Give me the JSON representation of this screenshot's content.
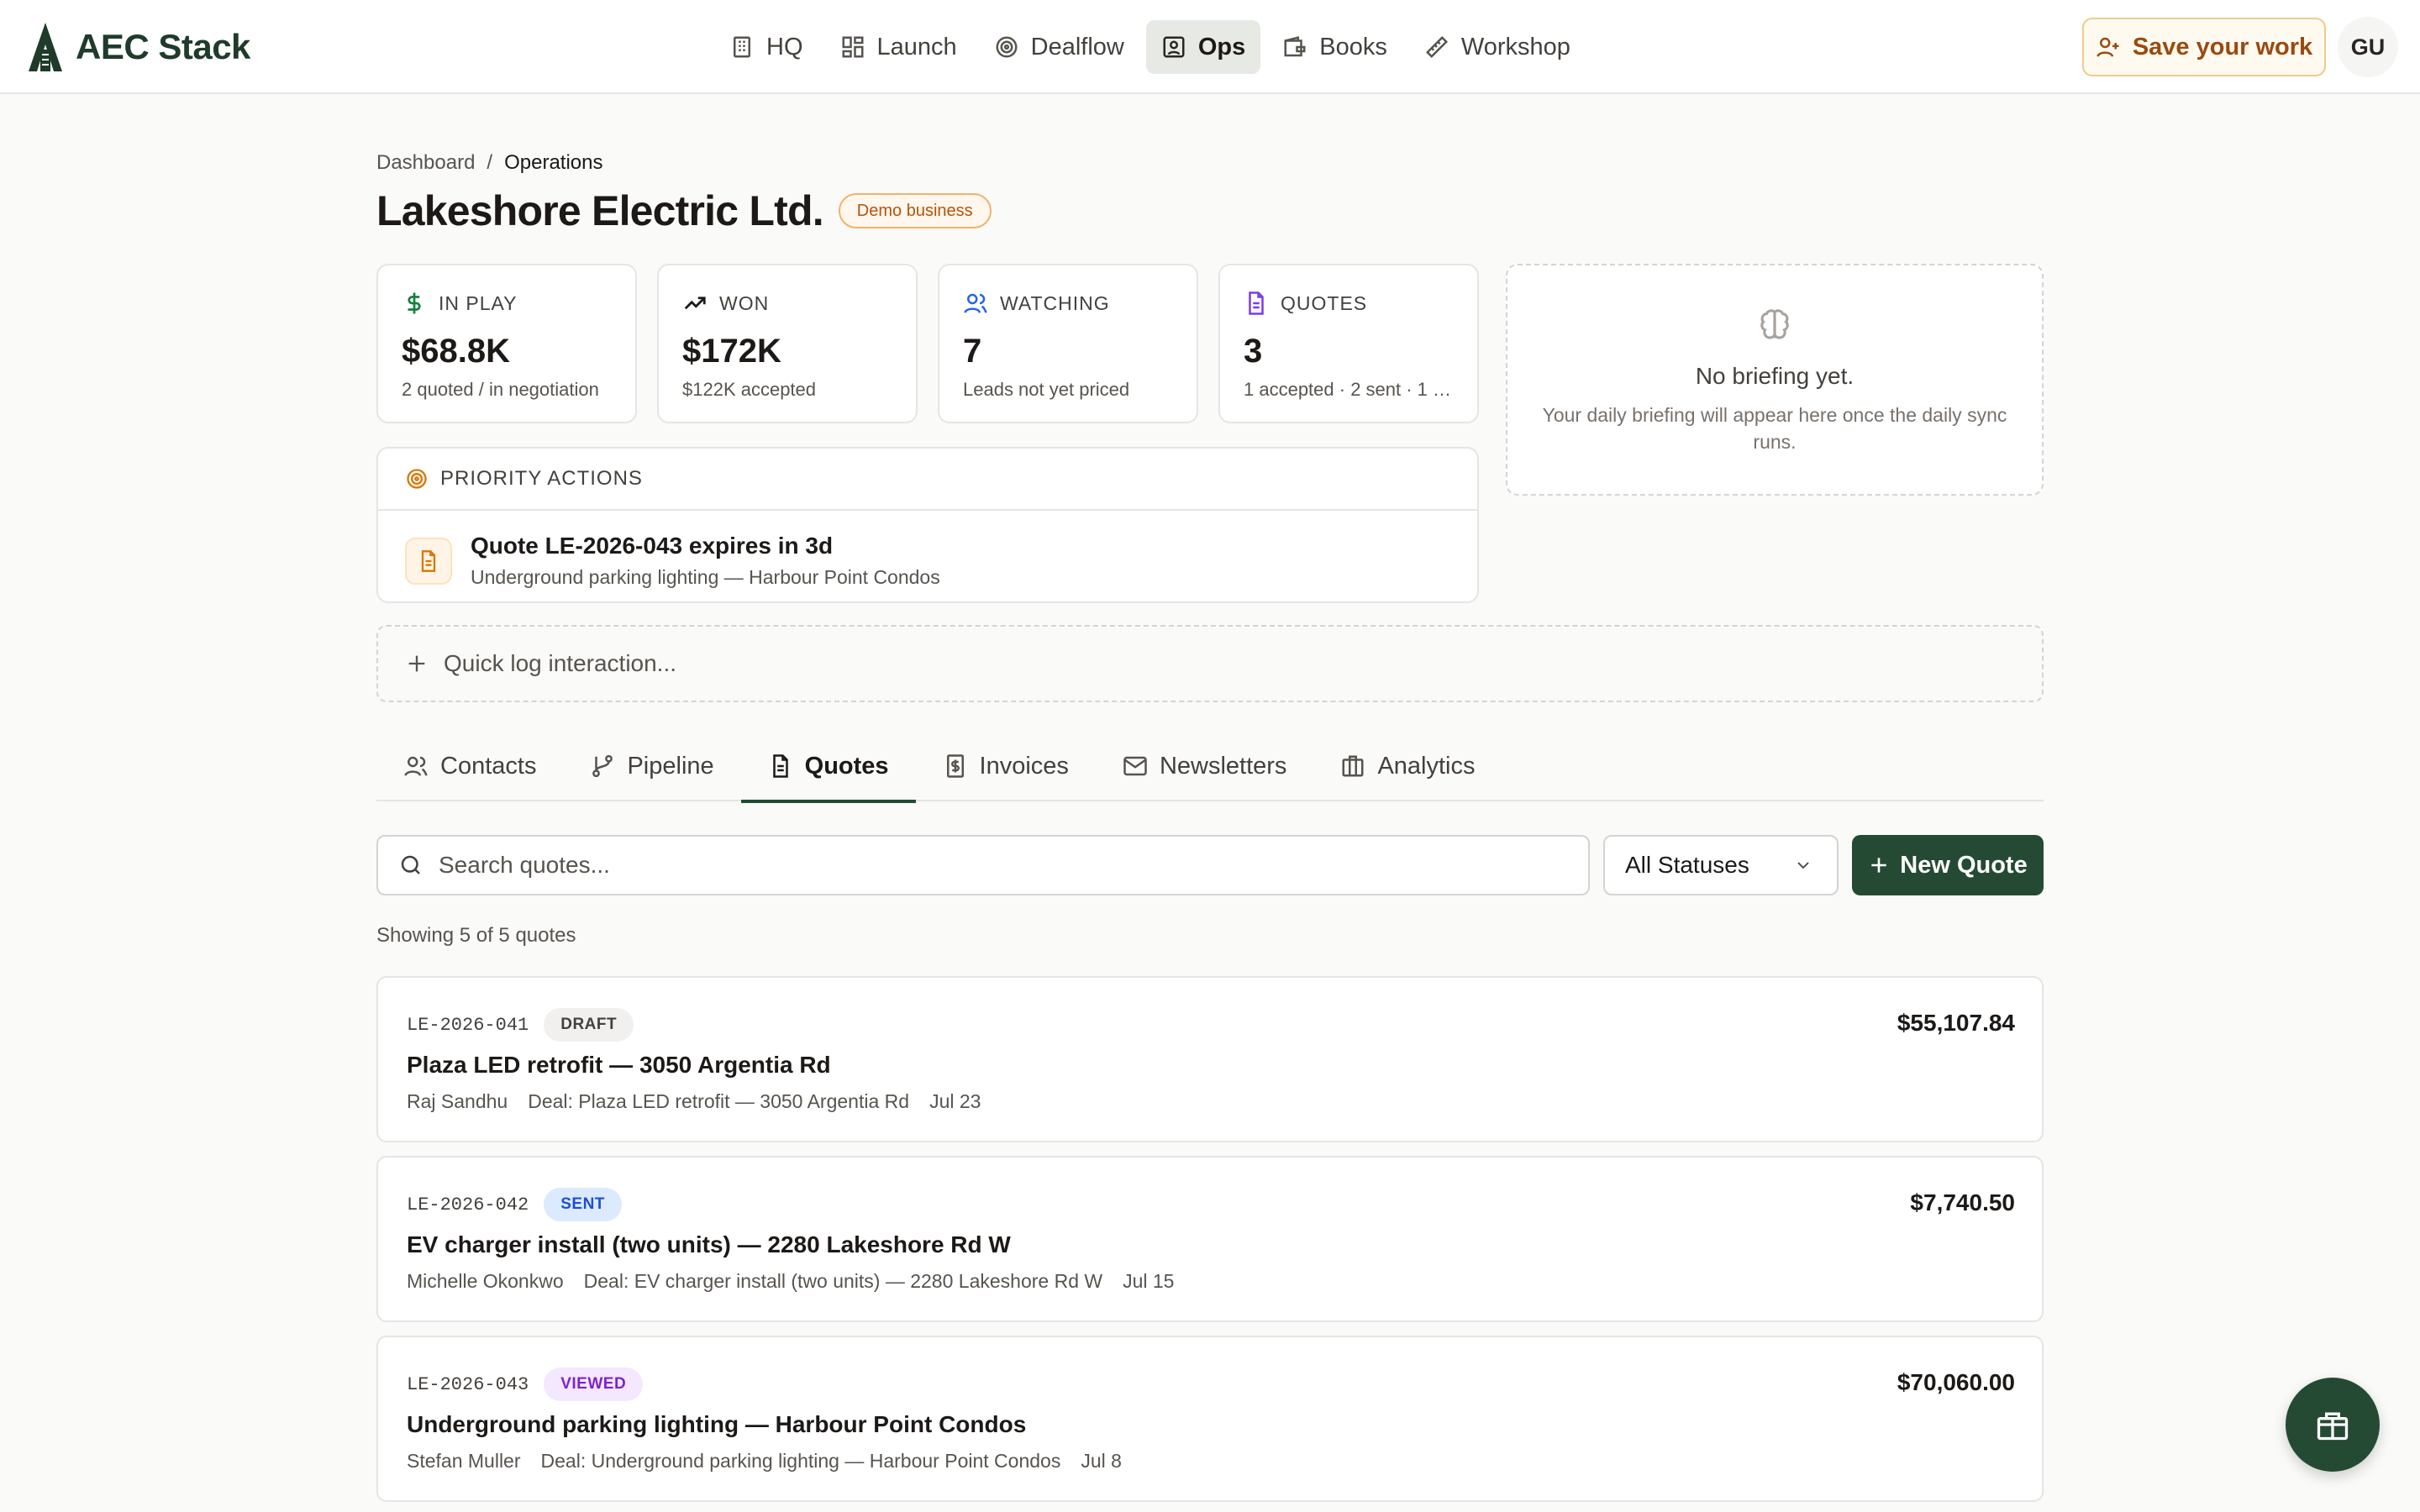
{
  "brand": {
    "name": "AEC Stack"
  },
  "nav": [
    {
      "label": "HQ",
      "icon": "building-icon"
    },
    {
      "label": "Launch",
      "icon": "grid-icon"
    },
    {
      "label": "Dealflow",
      "icon": "target-icon"
    },
    {
      "label": "Ops",
      "icon": "contact-icon",
      "active": true
    },
    {
      "label": "Books",
      "icon": "wallet-icon"
    },
    {
      "label": "Workshop",
      "icon": "ruler-icon"
    }
  ],
  "header_actions": {
    "save_label": "Save your work",
    "avatar_initials": "GU"
  },
  "breadcrumb": {
    "root": "Dashboard",
    "separator": "/",
    "current": "Operations"
  },
  "page": {
    "title": "Lakeshore Electric Ltd.",
    "badge": "Demo business"
  },
  "stats": [
    {
      "label": "IN PLAY",
      "value": "$68.8K",
      "sub": "2 quoted / in negotiation",
      "icon": "dollar-icon",
      "color": "#15803d"
    },
    {
      "label": "WON",
      "value": "$172K",
      "sub": "$122K accepted",
      "icon": "trending-up-icon",
      "color": "#1c1917"
    },
    {
      "label": "WATCHING",
      "value": "7",
      "sub": "Leads not yet priced",
      "icon": "users-icon",
      "color": "#2563eb"
    },
    {
      "label": "QUOTES",
      "value": "3",
      "sub": "1 accepted · 2 sent · 1 d...",
      "icon": "document-icon",
      "color": "#7c3aed"
    }
  ],
  "briefing": {
    "title": "No briefing yet.",
    "text": "Your daily briefing will appear here once the daily sync runs."
  },
  "priority": {
    "header": "PRIORITY ACTIONS",
    "items": [
      {
        "title": "Quote LE-2026-043 expires in 3d",
        "sub": "Underground parking lighting — Harbour Point Condos"
      }
    ]
  },
  "quick_log": {
    "label": "Quick log interaction..."
  },
  "tabs": [
    {
      "label": "Contacts",
      "icon": "users-icon"
    },
    {
      "label": "Pipeline",
      "icon": "git-branch-icon"
    },
    {
      "label": "Quotes",
      "icon": "document-icon",
      "active": true
    },
    {
      "label": "Invoices",
      "icon": "receipt-icon"
    },
    {
      "label": "Newsletters",
      "icon": "mail-icon"
    },
    {
      "label": "Analytics",
      "icon": "briefcase-icon"
    }
  ],
  "toolbar": {
    "search_placeholder": "Search quotes...",
    "status_value": "All Statuses",
    "new_label": "New Quote",
    "showing": "Showing 5 of 5 quotes"
  },
  "quotes": [
    {
      "id": "LE-2026-041",
      "status": "DRAFT",
      "status_bg": "#f1f0ee",
      "status_fg": "#44403c",
      "title": "Plaza LED retrofit — 3050 Argentia Rd",
      "contact": "Raj Sandhu",
      "deal": "Deal: Plaza LED retrofit — 3050 Argentia Rd",
      "date": "Jul 23",
      "amount": "$55,107.84"
    },
    {
      "id": "LE-2026-042",
      "status": "SENT",
      "status_bg": "#dbeafe",
      "status_fg": "#1d4ed8",
      "title": "EV charger install (two units) — 2280 Lakeshore Rd W",
      "contact": "Michelle Okonkwo",
      "deal": "Deal: EV charger install (two units) — 2280 Lakeshore Rd W",
      "date": "Jul 15",
      "amount": "$7,740.50"
    },
    {
      "id": "LE-2026-043",
      "status": "VIEWED",
      "status_bg": "#f3e8ff",
      "status_fg": "#7e22ce",
      "title": "Underground parking lighting — Harbour Point Condos",
      "contact": "Stefan Muller",
      "deal": "Deal: Underground parking lighting — Harbour Point Condos",
      "date": "Jul 8",
      "amount": "$70,060.00"
    }
  ]
}
